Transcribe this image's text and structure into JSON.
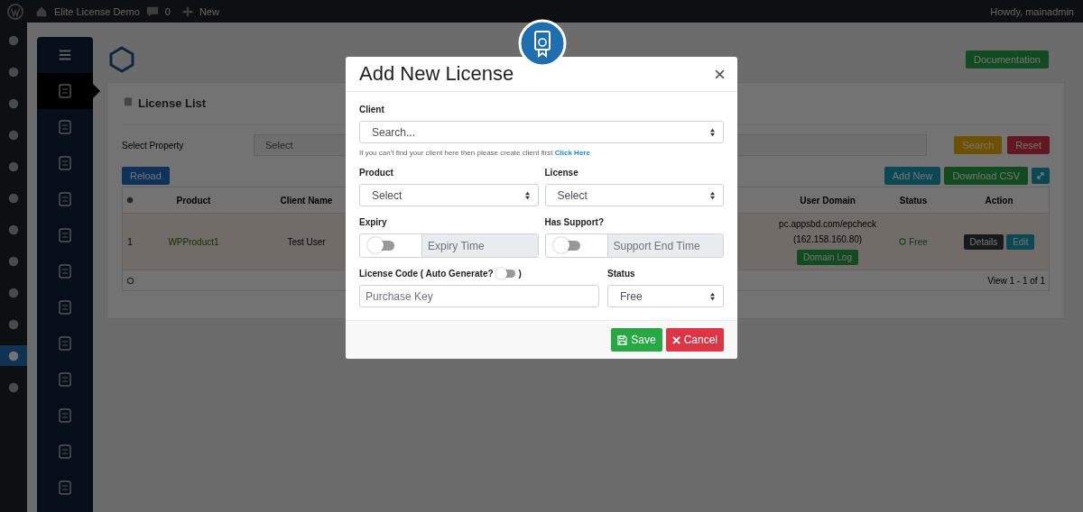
{
  "admin_bar": {
    "site_name": "Elite License Demo",
    "comments_count": "0",
    "new_label": "New",
    "greeting": "Howdy, mainadmin"
  },
  "wp_menu": [
    {
      "selected": false
    },
    {
      "selected": false
    },
    {
      "selected": false
    },
    {
      "selected": false
    },
    {
      "selected": false
    },
    {
      "selected": false
    },
    {
      "selected": false
    },
    {
      "selected": false
    },
    {
      "selected": false
    },
    {
      "selected": false
    },
    {
      "selected": true
    },
    {
      "selected": false
    }
  ],
  "plugin_sidebar": [
    {
      "selected": false
    },
    {
      "selected": true
    },
    {
      "selected": false
    },
    {
      "selected": false
    },
    {
      "selected": false
    },
    {
      "selected": false
    },
    {
      "selected": false
    },
    {
      "selected": false
    },
    {
      "selected": false
    },
    {
      "selected": false
    },
    {
      "selected": false
    },
    {
      "selected": false
    },
    {
      "selected": false
    }
  ],
  "header": {
    "documentation_button": "Documentation"
  },
  "license_list": {
    "title": "License List",
    "filter_label": "Select Property",
    "filter_select": "Select",
    "search_button": "Search",
    "reset_button": "Reset",
    "reload_button": "Reload",
    "add_new_button": "Add New",
    "download_button": "Download CSV",
    "columns_left": [
      "Product",
      "Client Name"
    ],
    "columns_right": [
      "User Domain",
      "Status",
      "Action"
    ],
    "rows": [
      {
        "index": "1",
        "product": "WPProduct1",
        "client_name": "Test User",
        "user_domain": "pc.appsbd.com/epcheck",
        "ip": "(162.158.160.80)",
        "domain_log_button": "Domain Log",
        "status": "Free",
        "details_button": "Details",
        "edit_button": "Edit"
      }
    ],
    "pager": "View 1 - 1 of 1"
  },
  "modal": {
    "title": "Add New License",
    "client_label": "Client",
    "client_select": "Search...",
    "client_hint": "If you can't find your client here then please create client first",
    "client_link": "Click Here",
    "product_label": "Product",
    "product_select": "Select",
    "license_label": "License",
    "license_select": "Select",
    "expiry_label": "Expiry",
    "expiry_toggle": {
      "on": false
    },
    "expiry_placeholder": "Expiry Time",
    "support_label": "Has Support?",
    "support_toggle": {
      "on": false
    },
    "support_placeholder": "Support End Time",
    "code_label_start": "License Code ( Auto Generate?",
    "code_toggle": {
      "on": false
    },
    "code_label_end": ")",
    "code_placeholder": "Purchase Key",
    "status_label": "Status",
    "status_select": "Free",
    "save_button": "Save",
    "cancel_button": "Cancel"
  }
}
